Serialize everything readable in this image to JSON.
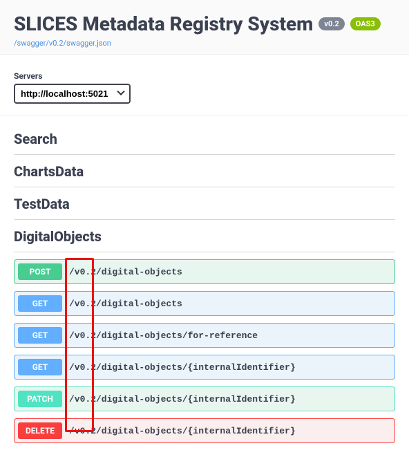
{
  "header": {
    "title": "SLICES Metadata Registry System",
    "version_badge": "v0.2",
    "oas_badge": "OAS3",
    "spec_link": "/swagger/v0.2/swagger.json"
  },
  "servers": {
    "label": "Servers",
    "selected": "http://localhost:5021"
  },
  "tags": [
    {
      "name": "Search"
    },
    {
      "name": "ChartsData"
    },
    {
      "name": "TestData"
    },
    {
      "name": "DigitalObjects"
    }
  ],
  "operations": [
    {
      "method": "POST",
      "method_class": "post",
      "path": "/v0.2/digital-objects"
    },
    {
      "method": "GET",
      "method_class": "get",
      "path": "/v0.2/digital-objects"
    },
    {
      "method": "GET",
      "method_class": "get",
      "path": "/v0.2/digital-objects/for-reference"
    },
    {
      "method": "GET",
      "method_class": "get",
      "path": "/v0.2/digital-objects/{internalIdentifier}"
    },
    {
      "method": "PATCH",
      "method_class": "patch",
      "path": "/v0.2/digital-objects/{internalIdentifier}"
    },
    {
      "method": "DELETE",
      "method_class": "delete",
      "path": "/v0.2/digital-objects/{internalIdentifier}"
    }
  ],
  "highlight": {
    "comment": "red box drawn around the '/v0.2/' segment column of all operation rows"
  }
}
